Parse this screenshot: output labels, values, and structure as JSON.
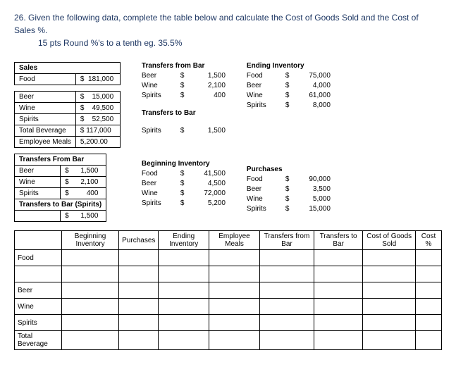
{
  "question": {
    "num": "26.",
    "text": "Given the following data, complete the table below and calculate the Cost of Goods Sold and the Cost of Sales %.",
    "sub": "15 pts Round %'s to a tenth eg. 35.5%"
  },
  "sales": {
    "hdr": "Sales",
    "rows": [
      [
        "Food",
        "$",
        "181,000"
      ],
      [
        "",
        "",
        ""
      ],
      [
        "Beer",
        "$",
        "15,000"
      ],
      [
        "Wine",
        "$",
        "49,500"
      ],
      [
        "Spirits",
        "$",
        "52,500"
      ]
    ],
    "tot": "Total Beverage",
    "tot_v": "$  117,000",
    "emp": "Employee Meals",
    "emp_v": "5,200.00"
  },
  "tfb": {
    "hdr": "Transfers From Bar",
    "rows": [
      [
        "Beer",
        "$",
        "1,500"
      ],
      [
        "Wine",
        "$",
        "2,100"
      ],
      [
        "Spirits",
        "$",
        "400"
      ]
    ]
  },
  "ttb": {
    "hdr": "Transfers to Bar (Spirits)",
    "rows": [
      [
        "",
        "$",
        "1,500"
      ]
    ]
  },
  "mid": [
    {
      "hdr": "Transfers from Bar",
      "rows": [
        [
          "Beer",
          "$",
          "1,500"
        ],
        [
          "Wine",
          "$",
          "2,100"
        ],
        [
          "Spirits",
          "$",
          "400"
        ]
      ]
    },
    {
      "hdr": "Transfers to Bar",
      "rows": [
        [
          "",
          "",
          " "
        ],
        [
          "Spirits",
          "$",
          "1,500"
        ]
      ]
    },
    {
      "hdr": "Beginning Inventory",
      "rows": [
        [
          "Food",
          "$",
          "41,500"
        ],
        [
          "Beer",
          "$",
          "4,500"
        ],
        [
          "Wine",
          "$",
          "72,000"
        ],
        [
          "Spirits",
          "$",
          "5,200"
        ]
      ]
    }
  ],
  "right": [
    {
      "hdr": "Ending Inventory",
      "rows": [
        [
          "Food",
          "$",
          "75,000"
        ],
        [
          "Beer",
          "$",
          "4,000"
        ],
        [
          "Wine",
          "$",
          "61,000"
        ],
        [
          "Spirits",
          "$",
          "8,000"
        ]
      ]
    },
    {
      "hdr": "Purchases",
      "rows": [
        [
          "Food",
          "$",
          "90,000"
        ],
        [
          "Beer",
          "$",
          "3,500"
        ],
        [
          "Wine",
          "$",
          "5,000"
        ],
        [
          "Spirits",
          "$",
          "15,000"
        ]
      ]
    }
  ],
  "wide": {
    "cols": [
      "",
      "Beginning Inventory",
      "Purchases",
      "Ending Inventory",
      "Employee Meals",
      "Transfers from Bar",
      "Transfers to Bar",
      "Cost of Goods Sold",
      "Cost %"
    ],
    "rows": [
      "Food",
      "",
      "Beer",
      "Wine",
      "Spirits",
      "Total Beverage"
    ]
  }
}
